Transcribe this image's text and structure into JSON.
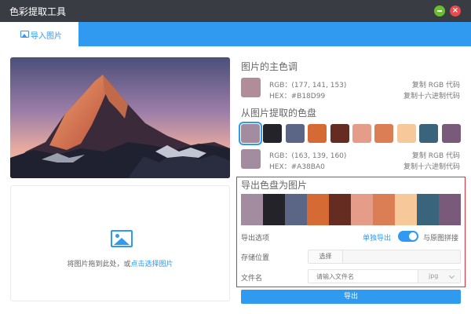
{
  "app": {
    "title": "色彩提取工具"
  },
  "window_controls": {
    "close_symbol": "×"
  },
  "tabs": [
    {
      "label": "导入图片",
      "icon": "image-icon",
      "active": true
    }
  ],
  "dropzone": {
    "text_before": "将图片拖到此处，或",
    "link_text": "点击选择图片",
    "icon": "image-icon"
  },
  "main_color": {
    "heading": "图片的主色调",
    "color": "#B18D99",
    "rgb_text": "RGB：(177, 141, 153)",
    "hex_text": "HEX：#B18D99",
    "copy_rgb": "复制 RGB 代码",
    "copy_hex": "复制十六进制代码"
  },
  "palette": {
    "heading": "从图片提取的色盘",
    "colors": [
      "#A38BA0",
      "#25232A",
      "#5B6686",
      "#D56A34",
      "#652D22",
      "#E59C88",
      "#DB7E56",
      "#F7C89A",
      "#3A647B",
      "#7A5A7A"
    ],
    "selected_index": 0,
    "selected_rgb_text": "RGB：(163, 139, 160)",
    "selected_hex_text": "HEX：#A38BA0",
    "copy_rgb": "复制 RGB 代码",
    "copy_hex": "复制十六进制代码"
  },
  "export": {
    "heading": "导出色盘为图片",
    "options_label": "导出选项",
    "option_single": "单独导出",
    "option_combined": "与原图拼接",
    "toggle_on": true,
    "location_label": "存储位置",
    "choose_button": "选择",
    "filename_label": "文件名",
    "filename_placeholder": "请输入文件名",
    "extension": "jpg",
    "export_button": "导出"
  },
  "colors": {
    "accent": "#2F9AF0",
    "titlebar": "#393C43",
    "highlight_border": "#E0323C"
  }
}
